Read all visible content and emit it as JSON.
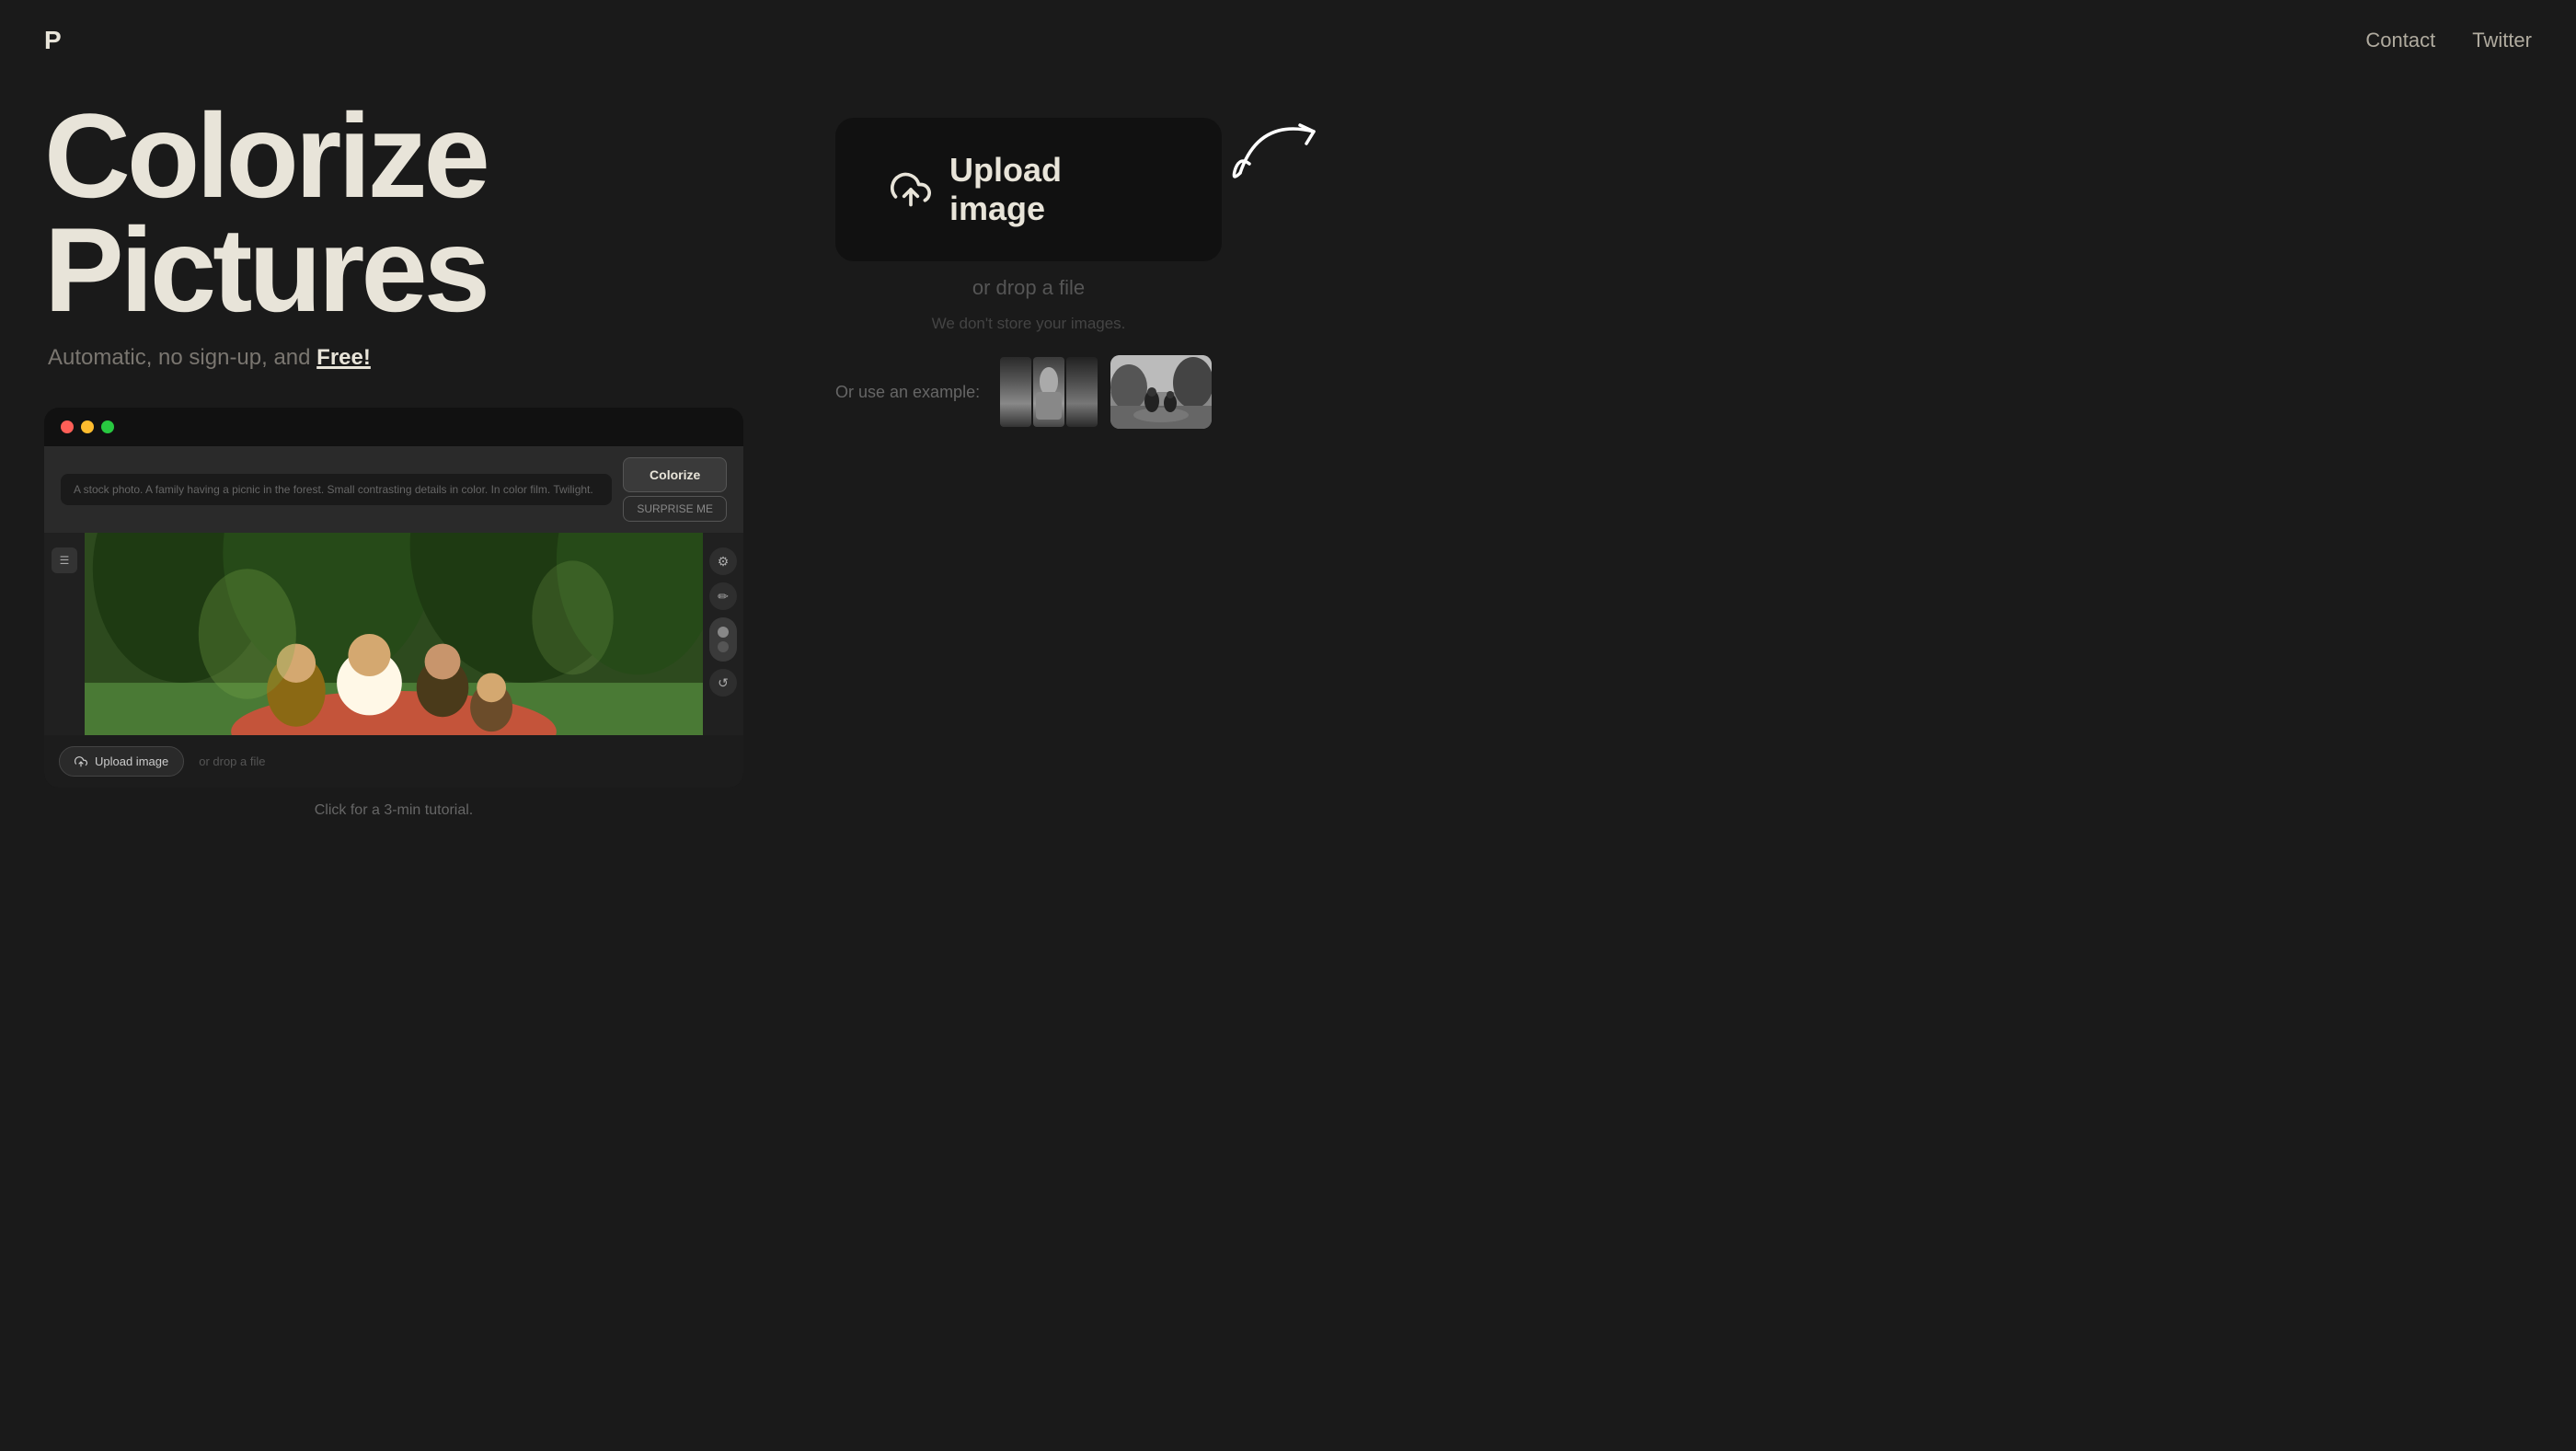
{
  "nav": {
    "logo": "P",
    "links": [
      {
        "id": "contact",
        "label": "Contact"
      },
      {
        "id": "twitter",
        "label": "Twitter"
      }
    ]
  },
  "hero": {
    "title_line1": "Colorize",
    "title_line2": "Pictures",
    "subtitle_prefix": "Automatic, no sign-up, and ",
    "subtitle_free": "Free!",
    "tutorial_text": "Click for a 3-min tutorial."
  },
  "mock_window": {
    "prompt_placeholder": "A stock photo. A family having a picnic in the forest. Small contrasting details in color. In color film. Twilight.",
    "colorize_btn": "Colorize",
    "surprise_btn": "SURPRISE ME",
    "upload_btn": "Upload image",
    "drop_hint": "or drop a file"
  },
  "upload": {
    "button_label": "Upload image",
    "drop_label": "or drop a file",
    "privacy_note": "We don't store your images."
  },
  "examples": {
    "label": "Or use an example:",
    "items": [
      {
        "id": "example-1",
        "alt": "Portrait strips example"
      },
      {
        "id": "example-2",
        "alt": "Outdoor scene example"
      }
    ]
  },
  "colors": {
    "bg": "#1a1a1a",
    "text_primary": "#e8e4d9",
    "text_muted": "#7a7670",
    "upload_bg": "#111111",
    "dot_red": "#ff5f57",
    "dot_yellow": "#febc2e",
    "dot_green": "#28c840"
  }
}
